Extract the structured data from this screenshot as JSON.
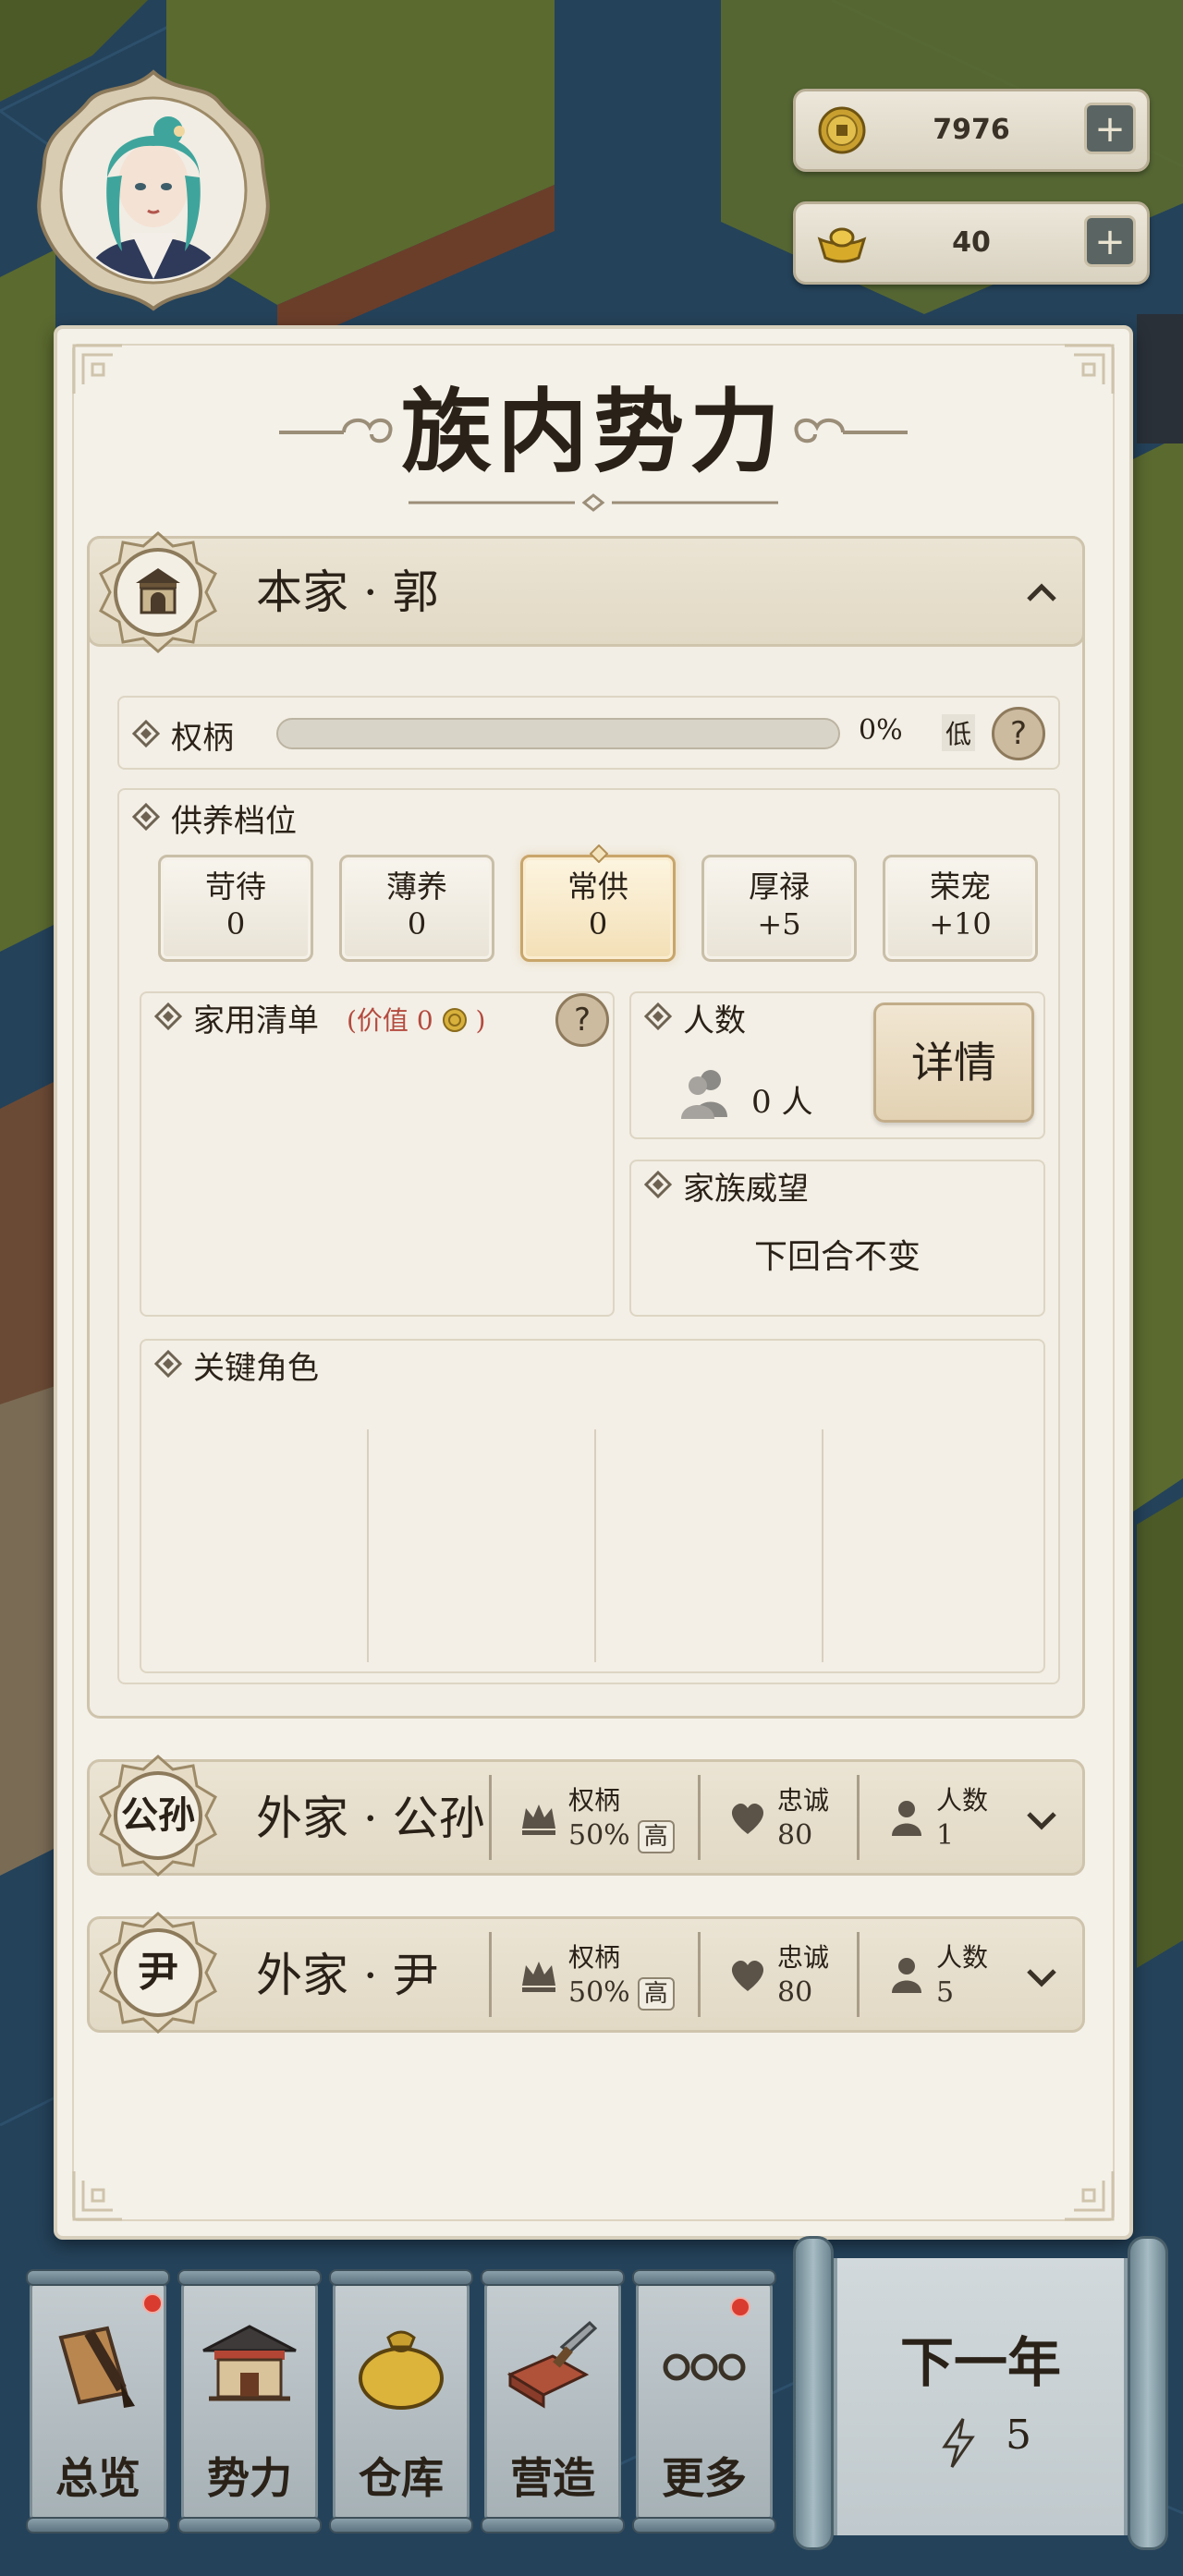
{
  "resources": {
    "coins": "7976",
    "ingots": "40"
  },
  "panel": {
    "title": "族内势力"
  },
  "main_family": {
    "emblem": "house-gate-icon",
    "name": "本家 · 郭",
    "power": {
      "label": "权柄",
      "percent_text": "0%",
      "percent_value": 0,
      "level": "低"
    },
    "support": {
      "label": "供养档位",
      "tiers": [
        {
          "name": "苛待",
          "value": "0"
        },
        {
          "name": "薄养",
          "value": "0"
        },
        {
          "name": "常供",
          "value": "0",
          "selected": true
        },
        {
          "name": "厚禄",
          "value": "+5"
        },
        {
          "name": "荣宠",
          "value": "+10"
        }
      ]
    },
    "household": {
      "label": "家用清单",
      "value_prefix": "(价值",
      "value": "0",
      "value_suffix": ")"
    },
    "headcount": {
      "label": "人数",
      "value": "0 人",
      "detail_button": "详情"
    },
    "prestige": {
      "label": "家族威望",
      "status": "下回合不变"
    },
    "key_roles": {
      "label": "关键角色"
    }
  },
  "other_families": [
    {
      "emblem_text": "公孙",
      "name": "外家 · 公孙",
      "power_label": "权柄",
      "power_value": "50%",
      "power_level": "高",
      "loyalty_label": "忠诚",
      "loyalty_value": "80",
      "count_label": "人数",
      "count_value": "1"
    },
    {
      "emblem_text": "尹",
      "name": "外家 · 尹",
      "power_label": "权柄",
      "power_value": "50%",
      "power_level": "高",
      "loyalty_label": "忠诚",
      "loyalty_value": "80",
      "count_label": "人数",
      "count_value": "5"
    }
  ],
  "bottom_nav": [
    {
      "label": "总览",
      "icon": "brush-scroll-icon",
      "badge": true
    },
    {
      "label": "势力",
      "icon": "palace-icon",
      "badge": false
    },
    {
      "label": "仓库",
      "icon": "money-bag-icon",
      "badge": false
    },
    {
      "label": "营造",
      "icon": "bricks-trowel-icon",
      "badge": false
    },
    {
      "label": "更多",
      "icon": "more-dots-icon",
      "badge": true
    }
  ],
  "next_year": {
    "label": "下一年",
    "energy": "5"
  },
  "colors": {
    "panel_bg": "#f4f1e9",
    "selected_tier": "#f3dfb6",
    "badge_red": "#d93b2f",
    "map_water": "#24425a",
    "map_grass": "#5b6a2f"
  }
}
